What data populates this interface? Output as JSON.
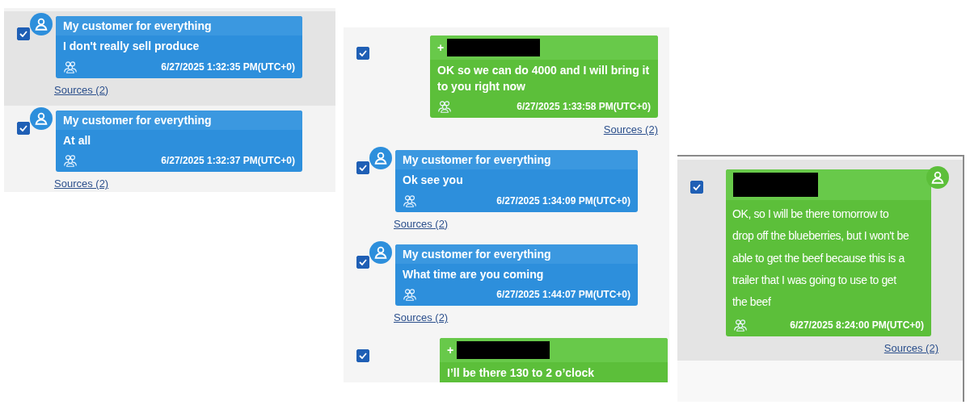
{
  "panels": [
    {
      "rows": [
        {
          "kind": "incoming",
          "selected": true,
          "checked": true,
          "sender": "My customer for everything",
          "text": "I don't really sell produce",
          "timestamp": "6/27/2025 1:32:35 PM(UTC+0)",
          "sources": "Sources (2)"
        },
        {
          "kind": "incoming",
          "selected": false,
          "checked": true,
          "sender": "My customer for everything",
          "text": "At all",
          "timestamp": "6/27/2025 1:32:37 PM(UTC+0)",
          "sources": "Sources (2)"
        }
      ]
    },
    {
      "rows": [
        {
          "kind": "outgoing",
          "selected": false,
          "checked": true,
          "sender": "+",
          "text": "OK so we can do 4000 and I will bring it to you right now",
          "timestamp": "6/27/2025 1:33:58 PM(UTC+0)",
          "sources": "Sources (2)"
        },
        {
          "kind": "incoming",
          "selected": false,
          "checked": true,
          "sender": "My customer for everything",
          "text": "Ok see you",
          "timestamp": "6/27/2025 1:34:09 PM(UTC+0)",
          "sources": "Sources (2)"
        },
        {
          "kind": "incoming",
          "selected": false,
          "checked": true,
          "sender": "My customer for everything",
          "text": "What time are you coming",
          "timestamp": "6/27/2025 1:44:07 PM(UTC+0)",
          "sources": "Sources (2)"
        },
        {
          "kind": "outgoing",
          "selected": false,
          "checked": true,
          "sender": "+",
          "text": "I’ll be there 130 to 2 o’clock"
        }
      ]
    },
    {
      "rows": [
        {
          "kind": "outgoing",
          "selected": true,
          "checked": true,
          "text": "OK, so I will be there tomorrow to drop off the blueberries, but I won't be able to get the beef because this is a trailer that I was going to use to get the beef",
          "timestamp": "6/27/2025 8:24:00 PM(UTC+0)",
          "sources": "Sources (2)"
        }
      ]
    }
  ]
}
